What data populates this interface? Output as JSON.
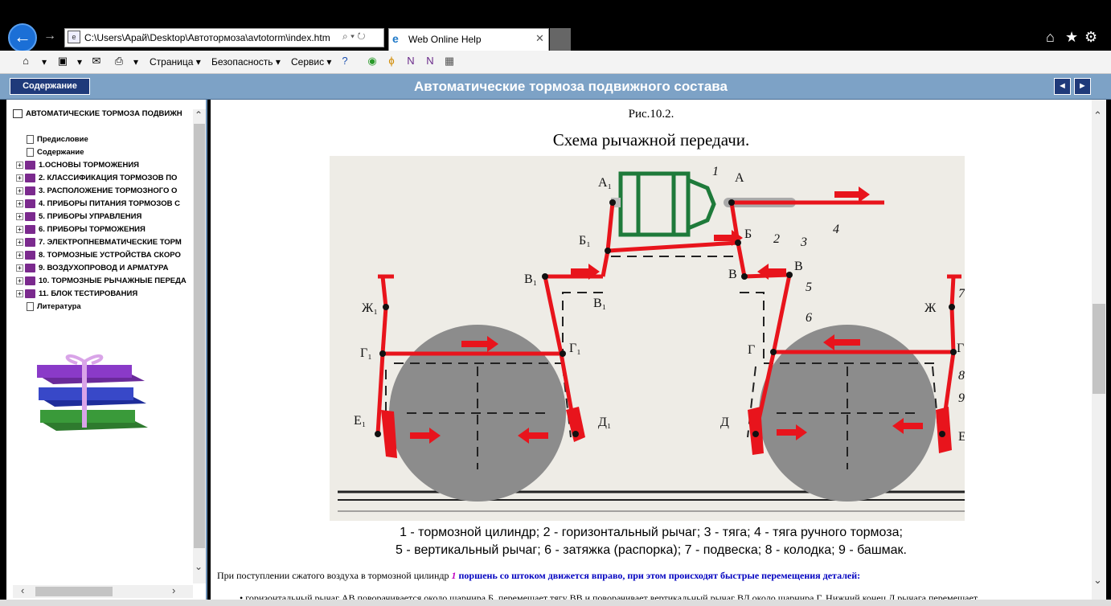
{
  "browser": {
    "address": "C:\\Users\\Арай\\Desktop\\Автотормоза\\avtotorm\\index.htm",
    "address_tools": "⌕ ▾ ↻",
    "tab_title": "Web Online Help",
    "tab_close": "✕"
  },
  "commandbar": {
    "page": "Страница ▾",
    "safety": "Безопасность ▾",
    "tools": "Сервис ▾"
  },
  "help": {
    "contents_button": "Содержание",
    "title": "Автоматические тормоза подвижного состава",
    "prev": "◄",
    "next": "►"
  },
  "toc": {
    "root": "АВТОМАТИЧЕСКИЕ ТОРМОЗА ПОДВИЖН",
    "items": [
      {
        "label": "Предисловие",
        "kind": "page"
      },
      {
        "label": "Содержание",
        "kind": "page"
      },
      {
        "label": "1.ОСНОВЫ ТОРМОЖЕНИЯ",
        "kind": "book"
      },
      {
        "label": "2. КЛАССИФИКАЦИЯ ТОРМОЗОВ ПО",
        "kind": "book"
      },
      {
        "label": "3. РАСПОЛОЖЕНИЕ ТОРМОЗНОГО О",
        "kind": "book"
      },
      {
        "label": "4. ПРИБОРЫ ПИТАНИЯ ТОРМОЗОВ С",
        "kind": "book"
      },
      {
        "label": "5. ПРИБОРЫ УПРАВЛЕНИЯ",
        "kind": "book"
      },
      {
        "label": "6. ПРИБОРЫ ТОРМОЖЕНИЯ",
        "kind": "book"
      },
      {
        "label": "7. ЭЛЕКТРОПНЕВМАТИЧЕСКИЕ ТОРМ",
        "kind": "book"
      },
      {
        "label": "8. ТОРМОЗНЫЕ УСТРОЙСТВА СКОРО",
        "kind": "book"
      },
      {
        "label": "9. ВОЗДУХОПРОВОД И АРМАТУРА",
        "kind": "book"
      },
      {
        "label": "10. ТОРМОЗНЫЕ РЫЧАЖНЫЕ ПЕРЕДА",
        "kind": "book"
      },
      {
        "label": "11. БЛОК ТЕСТИРОВАНИЯ",
        "kind": "book"
      },
      {
        "label": "Литература",
        "kind": "page"
      }
    ]
  },
  "content": {
    "figure_number": "Рис.10.2.",
    "figure_title": "Схема рычажной передачи.",
    "caption_line1": "1 - тормозной цилиндр; 2 - горизонтальный рычаг; 3 - тяга; 4 - тяга ручного тормоза;",
    "caption_line2": "5 - вертикальный рычаг; 6 - затяжка (распорка); 7 - подвеска; 8 - колодка; 9 - башмак.",
    "para_start": "При поступлении сжатого воздуха в тормозной цилиндр ",
    "para_num": "1",
    "para_rest": " поршень со штоком движется вправо, при этом происходят быстрые перемещения деталей:",
    "bullet": "• горизонтальный рычаг АВ поворачивается около шарнира Б, перемещает тягу ВВ и поворачивает вертикальный рычаг ВД около шарнира Г. Нижний конец Д рычага перемещает"
  },
  "diagram_labels": {
    "A1": "А₁",
    "A": "А",
    "B1": "Б₁",
    "B": "Б",
    "V1top": "В₁",
    "V1low": "В₁",
    "V": "В",
    "Vlow": "В",
    "Zh1": "Ж₁",
    "Zh": "Ж",
    "G1l": "Г₁",
    "G1r": "Г₁",
    "G": "Г",
    "Gr": "Г",
    "E1": "Е₁",
    "D1": "Д₁",
    "D": "Д",
    "E": "Е",
    "n1": "1",
    "n2": "2",
    "n3": "3",
    "n4": "4",
    "n5": "5",
    "n6": "6",
    "n7": "7",
    "n8": "8",
    "n9": "9"
  },
  "colors": {
    "header_bg": "#7da2c6",
    "button_bg": "#1f3a7a",
    "lever_red": "#e8141c",
    "cylinder_green": "#1e7a3a",
    "wheel_gray": "#8c8c8c"
  }
}
